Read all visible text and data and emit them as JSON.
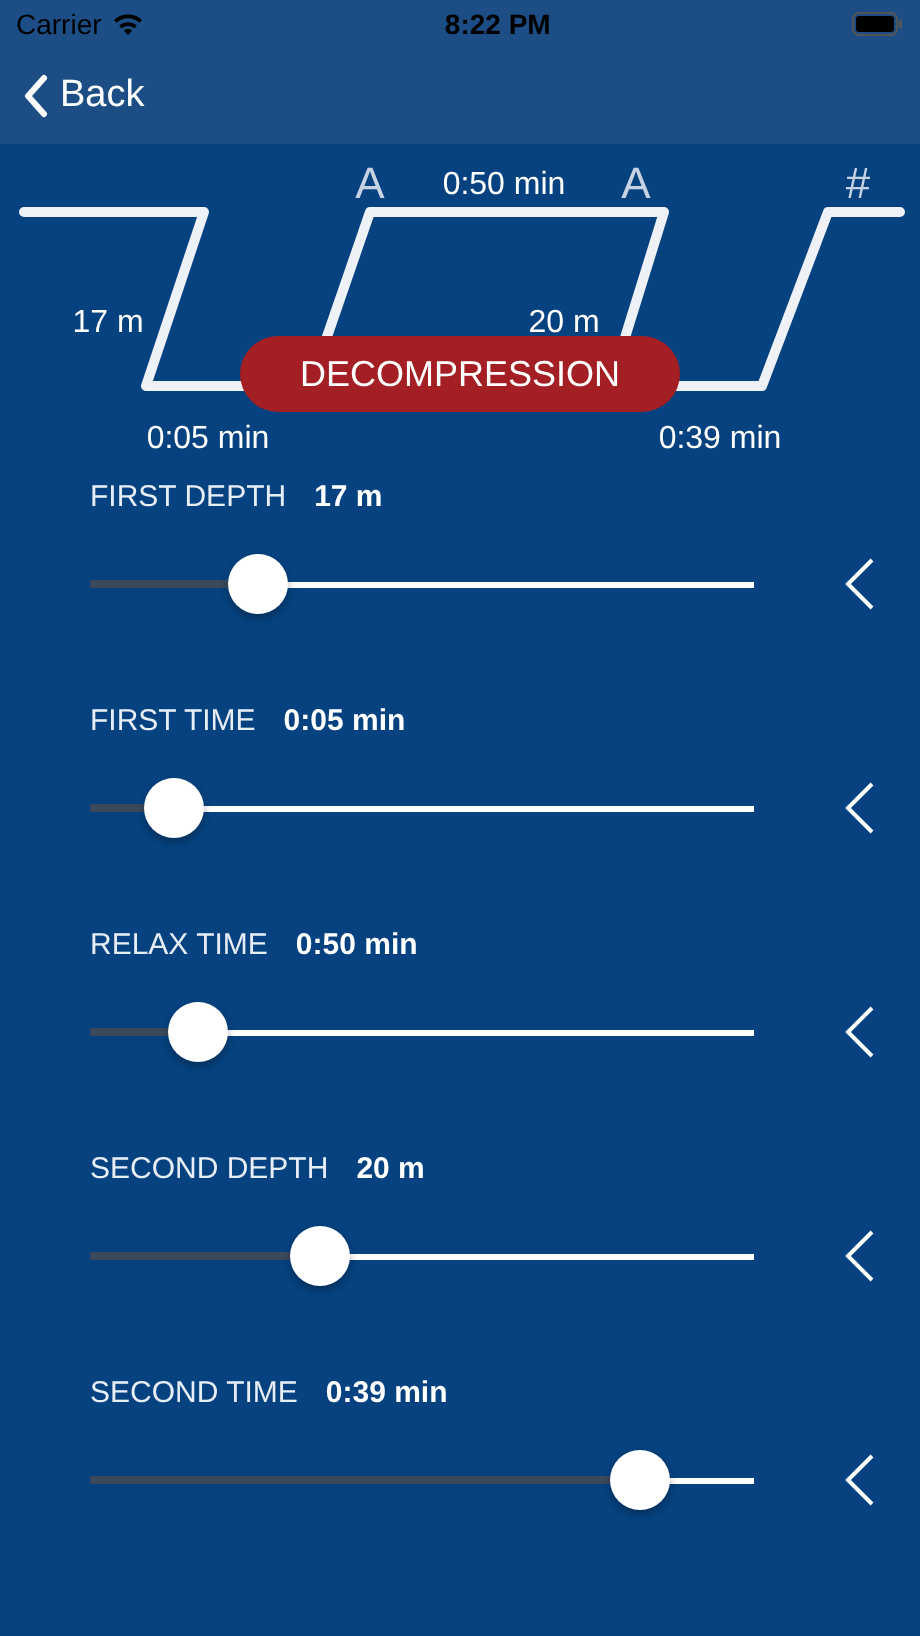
{
  "status_bar": {
    "carrier": "Carrier",
    "time": "8:22 PM"
  },
  "nav": {
    "back": "Back"
  },
  "profile": {
    "labels": [
      {
        "kind": "marker",
        "text": "A"
      },
      {
        "kind": "top-time",
        "text": "0:50 min"
      },
      {
        "kind": "marker2",
        "text": "A"
      },
      {
        "kind": "end",
        "text": "#"
      },
      {
        "kind": "depth1",
        "text": "17 m"
      },
      {
        "kind": "depth2",
        "text": "20 m"
      },
      {
        "kind": "time1",
        "text": "0:05 min"
      },
      {
        "kind": "time2",
        "text": "0:39 min"
      }
    ],
    "badge": "DECOMPRESSION"
  },
  "settings": [
    {
      "label": "FIRST DEPTH",
      "value": "17 m",
      "level": 0.23
    },
    {
      "label": "FIRST TIME",
      "value": "0:05 min",
      "level": 0.09
    },
    {
      "label": "RELAX TIME",
      "value": "0:50 min",
      "level": 0.13
    },
    {
      "label": "SECOND DEPTH",
      "value": "20 m",
      "level": 0.33
    },
    {
      "label": "SECOND TIME",
      "value": "0:39 min",
      "level": 0.86
    }
  ]
}
